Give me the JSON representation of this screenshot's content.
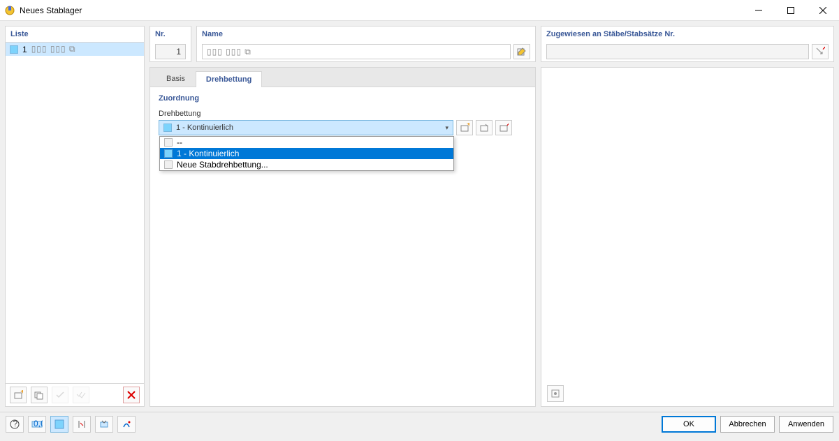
{
  "window": {
    "title": "Neues Stablager"
  },
  "left": {
    "header": "Liste",
    "items": [
      {
        "num": "1",
        "label": "▯▯▯ ▯▯▯ ⧉"
      }
    ]
  },
  "top": {
    "nr_label": "Nr.",
    "nr_value": "1",
    "name_label": "Name",
    "name_value": "▯▯▯ ▯▯▯ ⧉",
    "assign_label": "Zugewiesen an Stäbe/Stabsätze Nr.",
    "assign_value": ""
  },
  "tabs": {
    "basis": "Basis",
    "drehbettung": "Drehbettung"
  },
  "assignment": {
    "section": "Zuordnung",
    "label": "Drehbettung",
    "selected": "1 - Kontinuierlich",
    "options": [
      {
        "label": "--",
        "selected": false
      },
      {
        "label": "1 - Kontinuierlich",
        "selected": true
      },
      {
        "label": "Neue Stabdrehbettung...",
        "selected": false
      }
    ]
  },
  "buttons": {
    "ok": "OK",
    "cancel": "Abbrechen",
    "apply": "Anwenden"
  }
}
